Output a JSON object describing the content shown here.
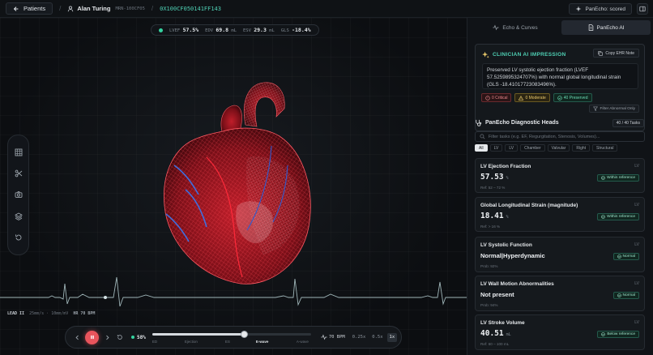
{
  "topbar": {
    "back_label": "Patients",
    "separator": "/",
    "patient_name": "Alan Turing",
    "mrn": "MRN-100CF05",
    "study_id": "0X100CF050141FF143",
    "status_label": "PanEcho: scored"
  },
  "metrics": [
    {
      "key": "LVEF",
      "value": "57.5%",
      "unit": ""
    },
    {
      "key": "EDV",
      "value": "69.8",
      "unit": "mL"
    },
    {
      "key": "ESV",
      "value": "29.3",
      "unit": "mL"
    },
    {
      "key": "GLS",
      "value": "-18.4%",
      "unit": ""
    }
  ],
  "tools": [
    "grid-icon",
    "scissors-icon",
    "camera-icon",
    "layers-icon",
    "reset-icon"
  ],
  "ecg": {
    "lead": "LEAD II",
    "speed": "25mm/s · 10mm/mV",
    "hr": "HR 70 BPM"
  },
  "playback": {
    "progress_pct": "58%",
    "progress_value": 0.58,
    "phases": [
      "ED",
      "Ejection",
      "ES",
      "E-wave",
      "A-wave"
    ],
    "active_phase": "E-wave",
    "bpm": "70 BPM",
    "speeds": [
      "0.25x",
      "0.5x",
      "1x"
    ],
    "selected_speed": "1x"
  },
  "panel": {
    "tabs": [
      {
        "label": "Echo & Curves",
        "active": false
      },
      {
        "label": "PanEcho AI",
        "active": true
      }
    ],
    "ai": {
      "title": "CLINICIAN AI IMPRESSION",
      "copy_label": "Copy EHR Note",
      "impression": "Preserved LV systolic ejection fraction (LVEF 57.5259895324707%) with normal global longitudinal strain (GLS -18.41017723083496%).",
      "badges": {
        "critical": "0 Critical",
        "moderate": "0 Moderate",
        "preserved": "40 Preserved"
      },
      "filter_label": "Filter Abnormal Only"
    },
    "heads": {
      "title": "PanEcho Diagnostic Heads",
      "count": "40 / 40 Tasks",
      "search_placeholder": "Filter tasks (e.g. EF, Regurgitation, Stenosis, Volumes)...",
      "chips": [
        "All",
        "LV",
        "LV",
        "Chamber",
        "Valvular",
        "Right",
        "Structural"
      ],
      "selected_chip": "All",
      "cards": [
        {
          "name": "LV Ejection Fraction",
          "group": "LV",
          "value": "57.53",
          "unit": "%",
          "status": "Within reference",
          "ref": "Ref: 52 – 72 %",
          "kind": "num"
        },
        {
          "name": "Global Longitudinal Strain (magnitude)",
          "group": "LV",
          "value": "18.41",
          "unit": "%",
          "status": "Within reference",
          "ref": "Ref: > 16 %",
          "kind": "num"
        },
        {
          "name": "LV Systolic Function",
          "group": "LV",
          "value": "Normal|Hyperdynamic",
          "unit": "",
          "status": "Normal",
          "ref": "Prob: 92%",
          "kind": "txt"
        },
        {
          "name": "LV Wall Motion Abnormalities",
          "group": "LV",
          "value": "Not present",
          "unit": "",
          "status": "Normal",
          "ref": "Prob: 94%",
          "kind": "txt"
        },
        {
          "name": "LV Stroke Volume",
          "group": "LV",
          "value": "40.51",
          "unit": "mL",
          "status": "Below reference",
          "ref": "Ref: 60 – 100 mL",
          "kind": "num"
        }
      ]
    }
  },
  "colors": {
    "accent": "#4fd1b5",
    "heart": "#e0303a",
    "record": "#e8545c",
    "ecg": "#9fb5b8"
  }
}
